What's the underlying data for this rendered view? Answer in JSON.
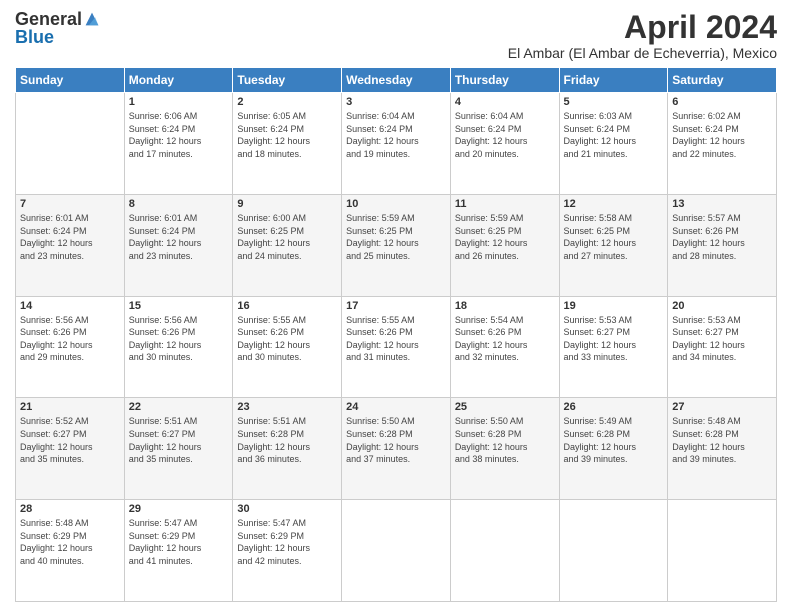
{
  "header": {
    "logo_general": "General",
    "logo_blue": "Blue",
    "month_title": "April 2024",
    "location": "El Ambar (El Ambar de Echeverria), Mexico"
  },
  "weekdays": [
    "Sunday",
    "Monday",
    "Tuesday",
    "Wednesday",
    "Thursday",
    "Friday",
    "Saturday"
  ],
  "weeks": [
    [
      {
        "day": "",
        "info": ""
      },
      {
        "day": "1",
        "info": "Sunrise: 6:06 AM\nSunset: 6:24 PM\nDaylight: 12 hours\nand 17 minutes."
      },
      {
        "day": "2",
        "info": "Sunrise: 6:05 AM\nSunset: 6:24 PM\nDaylight: 12 hours\nand 18 minutes."
      },
      {
        "day": "3",
        "info": "Sunrise: 6:04 AM\nSunset: 6:24 PM\nDaylight: 12 hours\nand 19 minutes."
      },
      {
        "day": "4",
        "info": "Sunrise: 6:04 AM\nSunset: 6:24 PM\nDaylight: 12 hours\nand 20 minutes."
      },
      {
        "day": "5",
        "info": "Sunrise: 6:03 AM\nSunset: 6:24 PM\nDaylight: 12 hours\nand 21 minutes."
      },
      {
        "day": "6",
        "info": "Sunrise: 6:02 AM\nSunset: 6:24 PM\nDaylight: 12 hours\nand 22 minutes."
      }
    ],
    [
      {
        "day": "7",
        "info": "Sunrise: 6:01 AM\nSunset: 6:24 PM\nDaylight: 12 hours\nand 23 minutes."
      },
      {
        "day": "8",
        "info": "Sunrise: 6:01 AM\nSunset: 6:24 PM\nDaylight: 12 hours\nand 23 minutes."
      },
      {
        "day": "9",
        "info": "Sunrise: 6:00 AM\nSunset: 6:25 PM\nDaylight: 12 hours\nand 24 minutes."
      },
      {
        "day": "10",
        "info": "Sunrise: 5:59 AM\nSunset: 6:25 PM\nDaylight: 12 hours\nand 25 minutes."
      },
      {
        "day": "11",
        "info": "Sunrise: 5:59 AM\nSunset: 6:25 PM\nDaylight: 12 hours\nand 26 minutes."
      },
      {
        "day": "12",
        "info": "Sunrise: 5:58 AM\nSunset: 6:25 PM\nDaylight: 12 hours\nand 27 minutes."
      },
      {
        "day": "13",
        "info": "Sunrise: 5:57 AM\nSunset: 6:26 PM\nDaylight: 12 hours\nand 28 minutes."
      }
    ],
    [
      {
        "day": "14",
        "info": "Sunrise: 5:56 AM\nSunset: 6:26 PM\nDaylight: 12 hours\nand 29 minutes."
      },
      {
        "day": "15",
        "info": "Sunrise: 5:56 AM\nSunset: 6:26 PM\nDaylight: 12 hours\nand 30 minutes."
      },
      {
        "day": "16",
        "info": "Sunrise: 5:55 AM\nSunset: 6:26 PM\nDaylight: 12 hours\nand 30 minutes."
      },
      {
        "day": "17",
        "info": "Sunrise: 5:55 AM\nSunset: 6:26 PM\nDaylight: 12 hours\nand 31 minutes."
      },
      {
        "day": "18",
        "info": "Sunrise: 5:54 AM\nSunset: 6:26 PM\nDaylight: 12 hours\nand 32 minutes."
      },
      {
        "day": "19",
        "info": "Sunrise: 5:53 AM\nSunset: 6:27 PM\nDaylight: 12 hours\nand 33 minutes."
      },
      {
        "day": "20",
        "info": "Sunrise: 5:53 AM\nSunset: 6:27 PM\nDaylight: 12 hours\nand 34 minutes."
      }
    ],
    [
      {
        "day": "21",
        "info": "Sunrise: 5:52 AM\nSunset: 6:27 PM\nDaylight: 12 hours\nand 35 minutes."
      },
      {
        "day": "22",
        "info": "Sunrise: 5:51 AM\nSunset: 6:27 PM\nDaylight: 12 hours\nand 35 minutes."
      },
      {
        "day": "23",
        "info": "Sunrise: 5:51 AM\nSunset: 6:28 PM\nDaylight: 12 hours\nand 36 minutes."
      },
      {
        "day": "24",
        "info": "Sunrise: 5:50 AM\nSunset: 6:28 PM\nDaylight: 12 hours\nand 37 minutes."
      },
      {
        "day": "25",
        "info": "Sunrise: 5:50 AM\nSunset: 6:28 PM\nDaylight: 12 hours\nand 38 minutes."
      },
      {
        "day": "26",
        "info": "Sunrise: 5:49 AM\nSunset: 6:28 PM\nDaylight: 12 hours\nand 39 minutes."
      },
      {
        "day": "27",
        "info": "Sunrise: 5:48 AM\nSunset: 6:28 PM\nDaylight: 12 hours\nand 39 minutes."
      }
    ],
    [
      {
        "day": "28",
        "info": "Sunrise: 5:48 AM\nSunset: 6:29 PM\nDaylight: 12 hours\nand 40 minutes."
      },
      {
        "day": "29",
        "info": "Sunrise: 5:47 AM\nSunset: 6:29 PM\nDaylight: 12 hours\nand 41 minutes."
      },
      {
        "day": "30",
        "info": "Sunrise: 5:47 AM\nSunset: 6:29 PM\nDaylight: 12 hours\nand 42 minutes."
      },
      {
        "day": "",
        "info": ""
      },
      {
        "day": "",
        "info": ""
      },
      {
        "day": "",
        "info": ""
      },
      {
        "day": "",
        "info": ""
      }
    ]
  ]
}
